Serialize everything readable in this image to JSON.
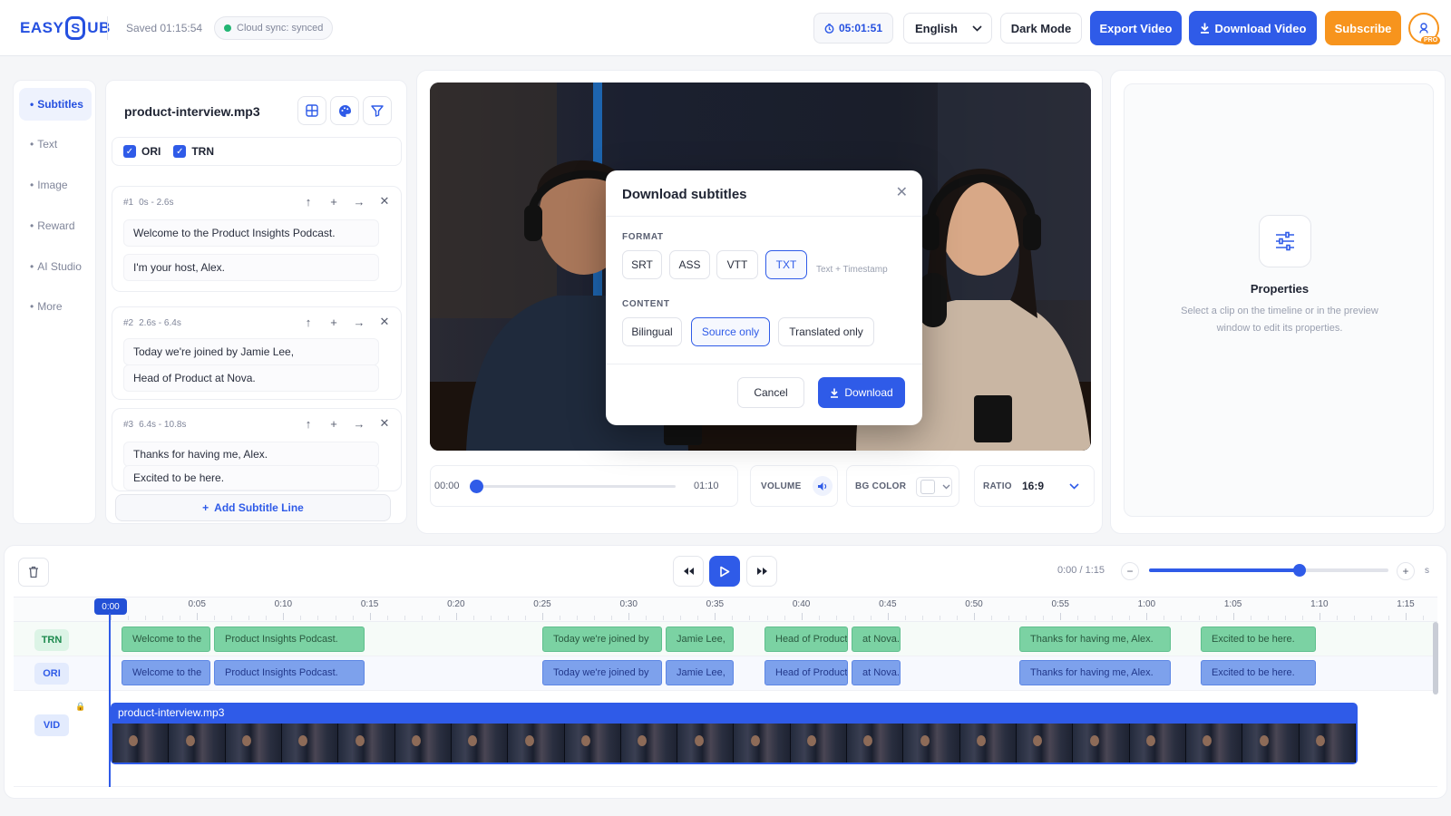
{
  "app": {
    "logo_left": "EASY",
    "logo_s": "S",
    "logo_right": "UB",
    "saved": "Saved 01:15:54",
    "sync": "Cloud sync: synced",
    "timer": "05:01:51",
    "language": "English",
    "dark_mode": "Dark Mode",
    "export": "Export Video",
    "download_video": "Download Video",
    "subscribe": "Subscribe",
    "pro": "PRO",
    "brand_color": "#2f5be8",
    "accent_color": "#f7941d"
  },
  "nav": {
    "items": [
      {
        "label": "Subtitles",
        "active": true
      },
      {
        "label": "Text",
        "active": false
      },
      {
        "label": "Image",
        "active": false
      },
      {
        "label": "Reward",
        "active": false
      },
      {
        "label": "AI Studio",
        "active": false
      },
      {
        "label": "More",
        "active": false
      }
    ]
  },
  "subtitles": {
    "filename": "product-interview.mp3",
    "ori_label": "ORI",
    "trn_label": "TRN",
    "ori_checked": true,
    "trn_checked": true,
    "cards": [
      {
        "id": "#1",
        "range": "0s - 2.6s",
        "lines": [
          "Welcome to the Product Insights Podcast.",
          "I'm your host, Alex."
        ]
      },
      {
        "id": "#2",
        "range": "2.6s - 6.4s",
        "lines": [
          "Today we're joined by Jamie Lee,",
          "Head of Product at Nova."
        ]
      },
      {
        "id": "#3",
        "range": "6.4s - 10.8s",
        "lines": [
          "Thanks for having me, Alex.",
          "Excited to be here."
        ]
      }
    ],
    "add_line": "Add Subtitle Line"
  },
  "player": {
    "current": "00:00",
    "duration": "01:10",
    "progress": 0,
    "volume_label": "VOLUME",
    "bg_color_label": "BG COLOR",
    "ratio_label": "RATIO",
    "ratio": "16:9"
  },
  "modal": {
    "title": "Download subtitles",
    "format_label": "FORMAT",
    "formats": [
      "SRT",
      "ASS",
      "VTT",
      "TXT"
    ],
    "selected_format": "TXT",
    "format_hint": "Text + Timestamp",
    "content_label": "CONTENT",
    "contents": [
      "Bilingual",
      "Source only",
      "Translated only"
    ],
    "selected_content": "Source only",
    "cancel": "Cancel",
    "download": "Download"
  },
  "properties": {
    "title": "Properties",
    "description": "Select a clip on the timeline or in the preview window to edit its properties."
  },
  "timeline": {
    "time": "0:00 / 1:15",
    "zoom_level": 0.63,
    "unit": "s",
    "playhead": "0:00",
    "ticks": [
      "0:05",
      "0:10",
      "0:15",
      "0:20",
      "0:25",
      "0:30",
      "0:35",
      "0:40",
      "0:45",
      "0:50",
      "0:55",
      "1:00",
      "1:05",
      "1:10",
      "1:15"
    ],
    "tracks": {
      "trn": "TRN",
      "ori": "ORI",
      "vid": "VID"
    },
    "clips": [
      {
        "text": "Welcome to the"
      },
      {
        "text": "Product Insights Podcast."
      },
      {
        "text": "Today we're joined by"
      },
      {
        "text": "Jamie Lee,"
      },
      {
        "text": "Head of Product"
      },
      {
        "text": "at Nova."
      },
      {
        "text": "Thanks for having me, Alex."
      },
      {
        "text": "Excited to be here."
      }
    ],
    "video_clip": "product-interview.mp3"
  }
}
